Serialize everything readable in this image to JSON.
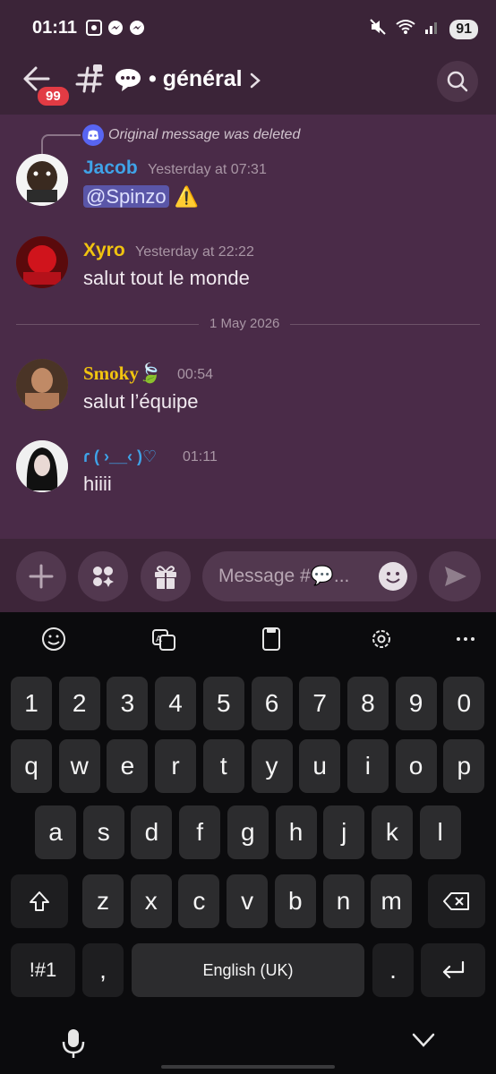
{
  "status_bar": {
    "time": "01:11",
    "battery": "91"
  },
  "header": {
    "unread_badge": "99",
    "channel_title": "• général",
    "channel_emoji": "💬"
  },
  "messages": [
    {
      "reply_note": "Original message was deleted",
      "author": "Jacob",
      "author_color": "#3fa3e8",
      "time": "Yesterday at 07:31",
      "mention": "@Spinzo",
      "text": "⚠️"
    },
    {
      "author": "Xyro",
      "author_color": "#f1c40f",
      "time": "Yesterday at 22:22",
      "text": "salut tout le monde"
    },
    {
      "author": "Smoky🍃",
      "author_color": "#f1c40f",
      "time": "00:54",
      "text": "salut l’équipe"
    },
    {
      "author": "ɾ ( ›__‹ )♡",
      "author_color": "#3fa3e8",
      "time": "01:11",
      "text": "hiiii"
    }
  ],
  "date_divider": "1 May 2026",
  "composer": {
    "placeholder": "Message #💬..."
  },
  "keyboard": {
    "row_numbers": [
      "1",
      "2",
      "3",
      "4",
      "5",
      "6",
      "7",
      "8",
      "9",
      "0"
    ],
    "row_1": [
      "q",
      "w",
      "e",
      "r",
      "t",
      "y",
      "u",
      "i",
      "o",
      "p"
    ],
    "row_2": [
      "a",
      "s",
      "d",
      "f",
      "g",
      "h",
      "j",
      "k",
      "l"
    ],
    "row_3": [
      "z",
      "x",
      "c",
      "v",
      "b",
      "n",
      "m"
    ],
    "symbols_key": "!#1",
    "comma_key": ",",
    "space_label": "English (UK)",
    "period_key": "."
  },
  "colors": {
    "accent_blurple": "#5865f2",
    "badge_red": "#e23b44"
  }
}
